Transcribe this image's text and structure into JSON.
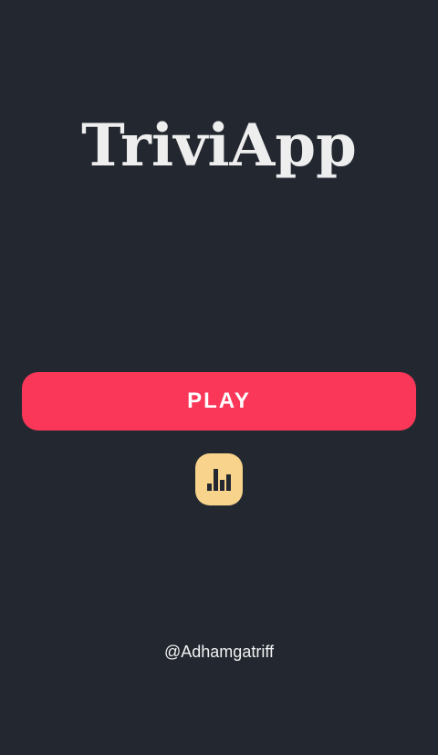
{
  "app": {
    "title": "TriviApp"
  },
  "actions": {
    "play_label": "PLAY",
    "leaderboard_icon": "bar-chart-icon"
  },
  "footer": {
    "credit": "@Adhamgatriff"
  },
  "colors": {
    "background": "#232830",
    "title_text": "#eeeeee",
    "play_button": "#fa3759",
    "leaderboard_button": "#f7d38b",
    "icon": "#232830",
    "credit_text": "#f2f2f2"
  }
}
